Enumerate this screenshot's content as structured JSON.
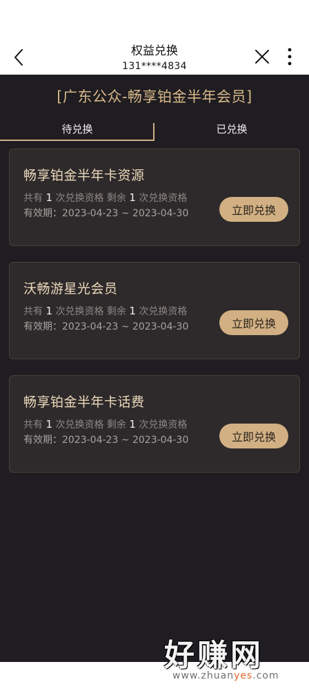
{
  "header": {
    "title": "权益兑换",
    "phone": "131****4834",
    "icons": [
      "chevron-left-icon",
      "close-icon",
      "more-vertical-icon"
    ]
  },
  "section_title": "[广东公众-畅享铂金半年会员]",
  "tabs": [
    {
      "label": "待兑换",
      "active": true
    },
    {
      "label": "已兑换",
      "active": false
    }
  ],
  "count_text": {
    "total_prefix": "共有",
    "total_suffix": "次兑换资格",
    "remain_prefix": "剩余",
    "remain_suffix": "次兑换资格",
    "valid_prefix": "有效期："
  },
  "cards": [
    {
      "title": "畅享铂金半年卡资源",
      "total": "1",
      "remaining": "1",
      "valid": "2023-04-23 ~ 2023-04-30",
      "button": "立即兑换"
    },
    {
      "title": "沃畅游星光会员",
      "total": "1",
      "remaining": "1",
      "valid": "2023-04-23 ~ 2023-04-30",
      "button": "立即兑换"
    },
    {
      "title": "畅享铂金半年卡话费",
      "total": "1",
      "remaining": "1",
      "valid": "2023-04-23 ~ 2023-04-30",
      "button": "立即兑换"
    }
  ],
  "watermark": {
    "text": "好赚网",
    "url_pre": "www.zhuan",
    "url_accent": "yes",
    "url_post": ".com"
  },
  "colors": {
    "background": "#1f1d21",
    "accent_gold": "#d2b083",
    "card_bg": "#2e2a2b"
  }
}
